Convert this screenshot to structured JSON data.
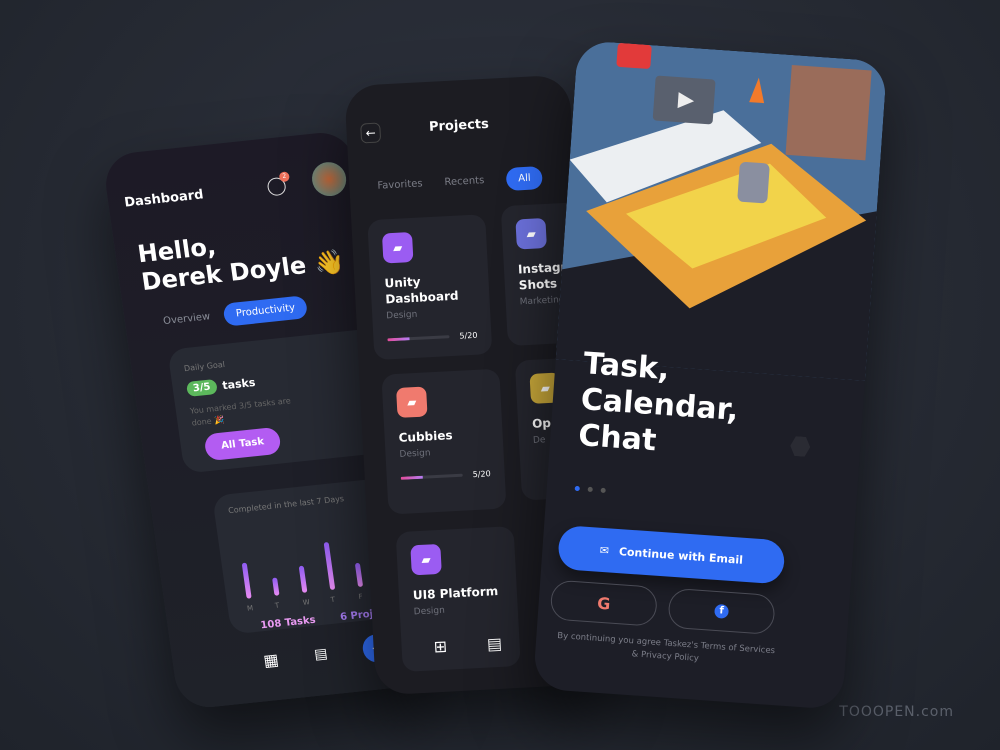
{
  "dashboard": {
    "title": "Dashboard",
    "notification_count": "2",
    "greeting_line1": "Hello,",
    "greeting_line2": "Derek Doyle",
    "wave_emoji": "👋",
    "tabs": [
      {
        "label": "Overview"
      },
      {
        "label": "Productivity",
        "active": true
      }
    ],
    "daily_goal": {
      "label": "Daily Goal",
      "badge": "3/5",
      "unit": "tasks",
      "message": "You marked 3/5 tasks are done 🎉",
      "button": "All Task",
      "progress": 0.6
    },
    "weekly": {
      "title": "Completed in the last 7 Days",
      "days": [
        "M",
        "T",
        "W",
        "T",
        "F",
        "S"
      ],
      "levels": [
        0.6,
        0.3,
        0.45,
        0.8,
        0.4,
        0.2
      ],
      "tasks": "108 Tasks",
      "projects": "6 Projects"
    },
    "fab": "+"
  },
  "projects": {
    "title": "Projects",
    "tabs": [
      {
        "label": "Favorites"
      },
      {
        "label": "Recents"
      },
      {
        "label": "All",
        "active": true
      }
    ],
    "items": [
      {
        "name": "Unity Dashboard",
        "category": "Design",
        "progress": "5/20",
        "color": "#9b5cf2"
      },
      {
        "name": "Instagram Shots",
        "category": "Marketing",
        "color": "#6a6fd8"
      },
      {
        "name": "Cubbies",
        "category": "Design",
        "progress": "5/20",
        "color": "#f07a6e"
      },
      {
        "name": "Op",
        "category": "De",
        "color": "#c9a83a"
      },
      {
        "name": "UI8 Platform",
        "category": "Design",
        "color": "#9b5cf2"
      }
    ]
  },
  "onboarding": {
    "headline_1": "Task,",
    "headline_2": "Calendar,",
    "headline_3": "Chat",
    "page_index": 1,
    "page_count": 3,
    "email_button": "Continue with Email",
    "google": "G",
    "facebook": "f",
    "terms": "By continuing you agree Taskez's Terms of Services & Privacy Policy"
  },
  "watermark": "TOOOPEN.com",
  "colors": {
    "accent": "#2f6bf2",
    "purple": "#b35cf2",
    "green": "#5cb85c"
  }
}
